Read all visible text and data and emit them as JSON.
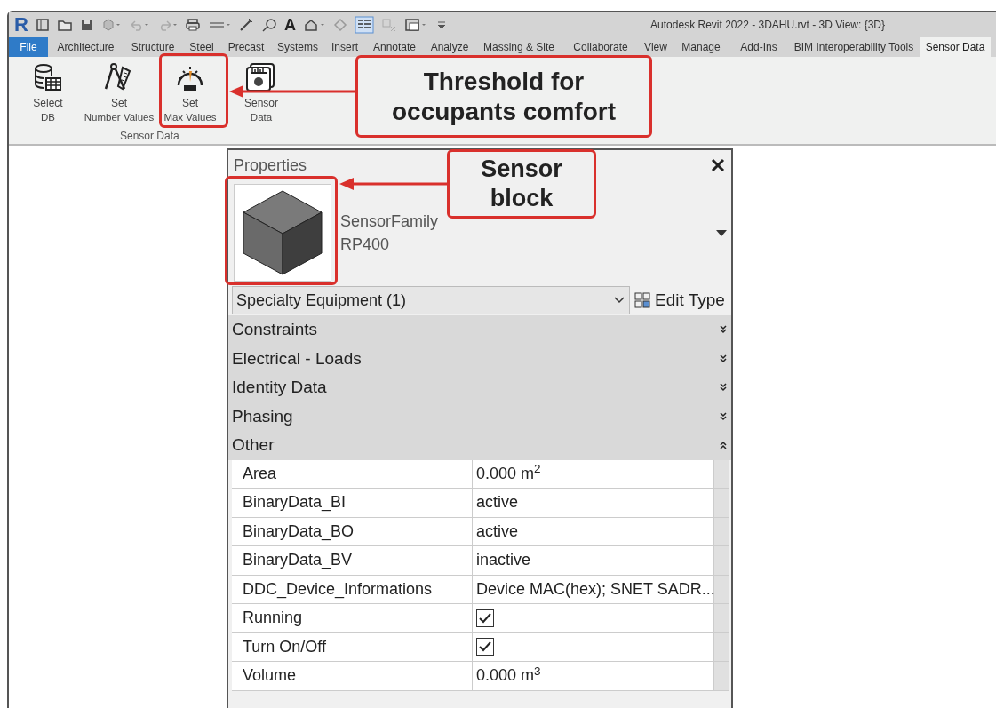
{
  "window": {
    "title": "Autodesk Revit 2022 - 3DAHU.rvt - 3D View: {3D}"
  },
  "quick_access": {
    "logo": "R",
    "text_tool": "A"
  },
  "ribbon_tabs": [
    {
      "label": "File",
      "kind": "file",
      "selected": false
    },
    {
      "label": "Architecture",
      "kind": "tab",
      "selected": false
    },
    {
      "label": "Structure",
      "kind": "tab",
      "selected": false
    },
    {
      "label": "Steel",
      "kind": "tab",
      "selected": false
    },
    {
      "label": "Precast",
      "kind": "tab",
      "selected": false
    },
    {
      "label": "Systems",
      "kind": "tab",
      "selected": false
    },
    {
      "label": "Insert",
      "kind": "tab",
      "selected": false
    },
    {
      "label": "Annotate",
      "kind": "tab",
      "selected": false
    },
    {
      "label": "Analyze",
      "kind": "tab",
      "selected": false
    },
    {
      "label": "Massing & Site",
      "kind": "tab",
      "selected": false
    },
    {
      "label": "Collaborate",
      "kind": "tab",
      "selected": false
    },
    {
      "label": "View",
      "kind": "tab",
      "selected": false
    },
    {
      "label": "Manage",
      "kind": "tab",
      "selected": false
    },
    {
      "label": "Add-Ins",
      "kind": "tab",
      "selected": false
    },
    {
      "label": "BIM Interoperability Tools",
      "kind": "tab",
      "selected": false
    },
    {
      "label": "Sensor Data",
      "kind": "tab",
      "selected": true
    }
  ],
  "ribbon_group": {
    "label": "Sensor Data",
    "buttons": [
      {
        "line1": "Select",
        "line2": "DB"
      },
      {
        "line1": "Set",
        "line2": "Number Values"
      },
      {
        "line1": "Set",
        "line2": "Max Values"
      },
      {
        "line1": "Sensor",
        "line2": "Data"
      }
    ]
  },
  "properties": {
    "title": "Properties",
    "family": "SensorFamily",
    "type": "RP400",
    "selector": "Specialty Equipment (1)",
    "edit_type": "Edit Type",
    "groups": [
      {
        "label": "Constraints",
        "expanded": false
      },
      {
        "label": "Electrical - Loads",
        "expanded": false
      },
      {
        "label": "Identity Data",
        "expanded": false
      },
      {
        "label": "Phasing",
        "expanded": false
      },
      {
        "label": "Other",
        "expanded": true
      }
    ],
    "rows": [
      {
        "name": "Area",
        "kind": "text",
        "value": "0.000 m$^{2}$"
      },
      {
        "name": "BinaryData_BI",
        "kind": "text",
        "value": "active"
      },
      {
        "name": "BinaryData_BO",
        "kind": "text",
        "value": "active"
      },
      {
        "name": "BinaryData_BV",
        "kind": "text",
        "value": "inactive"
      },
      {
        "name": "DDC_Device_Informations",
        "kind": "text",
        "value": "Device MAC(hex); SNET SADR..."
      },
      {
        "name": "Running",
        "kind": "checkbox",
        "checked": true
      },
      {
        "name": "Turn On/Off",
        "kind": "checkbox",
        "checked": true
      },
      {
        "name": "Volume",
        "kind": "text",
        "value": "0.000 m$^{3}$"
      }
    ]
  },
  "callouts": [
    {
      "text": "Threshold for occupants comfort"
    },
    {
      "text": "Sensor block"
    }
  ]
}
